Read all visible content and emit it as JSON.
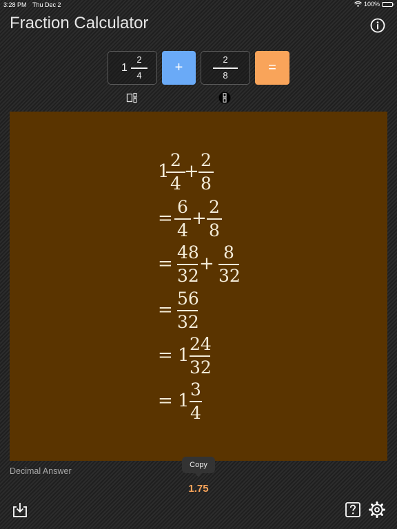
{
  "status_bar": {
    "time": "3:28 PM",
    "date": "Thu Dec 2",
    "battery": "100%",
    "icons": [
      "wifi-icon",
      "battery-icon"
    ]
  },
  "header": {
    "title": "Fraction Calculator",
    "info_icon": "info-icon"
  },
  "input": {
    "first": {
      "whole": "1",
      "numerator": "2",
      "denominator": "4"
    },
    "operator": "+",
    "second": {
      "numerator": "2",
      "denominator": "8"
    },
    "equals": "=",
    "toggle_icons": [
      "mixed-number-icon",
      "fraction-icon"
    ]
  },
  "work": {
    "lines": [
      {
        "prefix": "",
        "terms": [
          {
            "whole": "1",
            "n": "2",
            "d": "4"
          },
          {
            "op": "+"
          },
          {
            "n": "2",
            "d": "8"
          }
        ]
      },
      {
        "prefix": "=",
        "terms": [
          {
            "n": "6",
            "d": "4"
          },
          {
            "op": "+"
          },
          {
            "n": "2",
            "d": "8"
          }
        ]
      },
      {
        "prefix": "=",
        "terms": [
          {
            "n": "48",
            "d": "32"
          },
          {
            "op": "+"
          },
          {
            "n": "8",
            "d": "32"
          }
        ]
      },
      {
        "prefix": "=",
        "terms": [
          {
            "n": "56",
            "d": "32"
          }
        ]
      },
      {
        "prefix": "=",
        "terms": [
          {
            "whole": "1",
            "n": "24",
            "d": "32"
          }
        ]
      },
      {
        "prefix": "=",
        "terms": [
          {
            "whole": "1",
            "n": "3",
            "d": "4"
          }
        ]
      }
    ]
  },
  "answer": {
    "label": "Decimal Answer",
    "copy_label": "Copy",
    "value": "1.75"
  },
  "bottom_bar": {
    "icons": [
      "download-icon",
      "help-icon",
      "settings-icon"
    ]
  },
  "colors": {
    "background": "#262626",
    "panel": "#5a3400",
    "operator_button": "#6aaaf7",
    "equals_button": "#f9a45a",
    "answer": "#f9a45a"
  }
}
